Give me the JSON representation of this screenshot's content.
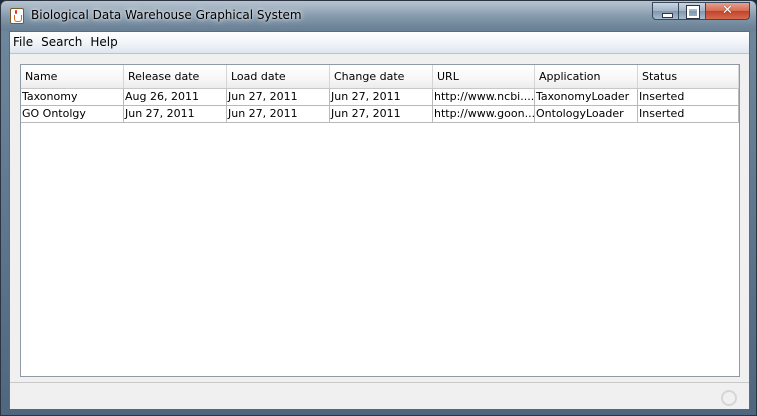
{
  "window": {
    "title": "Biological Data Warehouse Graphical System",
    "icon": "java-cup-icon"
  },
  "menubar": {
    "items": [
      "File",
      "Search",
      "Help"
    ]
  },
  "table": {
    "columns": [
      "Name",
      "Release date",
      "Load date",
      "Change date",
      "URL",
      "Application",
      "Status"
    ],
    "rows": [
      [
        "Taxonomy",
        "Aug 26, 2011",
        "Jun 27, 2011",
        "Jun 27, 2011",
        "http://www.ncbi....",
        "TaxonomyLoader",
        "Inserted"
      ],
      [
        "GO Ontolgy",
        "Jun 27, 2011",
        "Jun 27, 2011",
        "Jun 27, 2011",
        "http://www.goon...",
        "OntologyLoader",
        "Inserted"
      ]
    ]
  },
  "colors": {
    "titlebar": "#6f879d",
    "close_button": "#c0432a",
    "client_background": "#f0f0f0"
  }
}
